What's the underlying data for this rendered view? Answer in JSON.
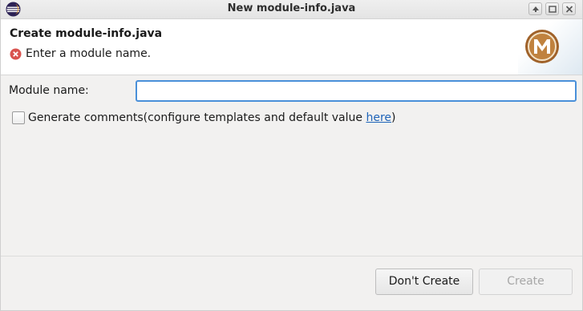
{
  "window": {
    "title": "New module-info.java"
  },
  "header": {
    "heading": "Create module-info.java",
    "error_message": "Enter a module name."
  },
  "form": {
    "module_name_label": "Module name:",
    "module_name_value": "",
    "generate_comments_checked": false,
    "generate_comments_label": "Generate comments(configure templates and default value ",
    "generate_comments_link": "here",
    "generate_comments_suffix": ")"
  },
  "buttons": {
    "dont_create": "Don't Create",
    "create": "Create",
    "create_enabled": false
  },
  "icons": {
    "app": "eclipse-icon",
    "error": "error-icon",
    "banner": "module-banner-icon"
  },
  "colors": {
    "focus_border": "#4a90d9",
    "link": "#1e63b8",
    "error_red": "#d9534f",
    "banner_brown": "#a0622a"
  }
}
